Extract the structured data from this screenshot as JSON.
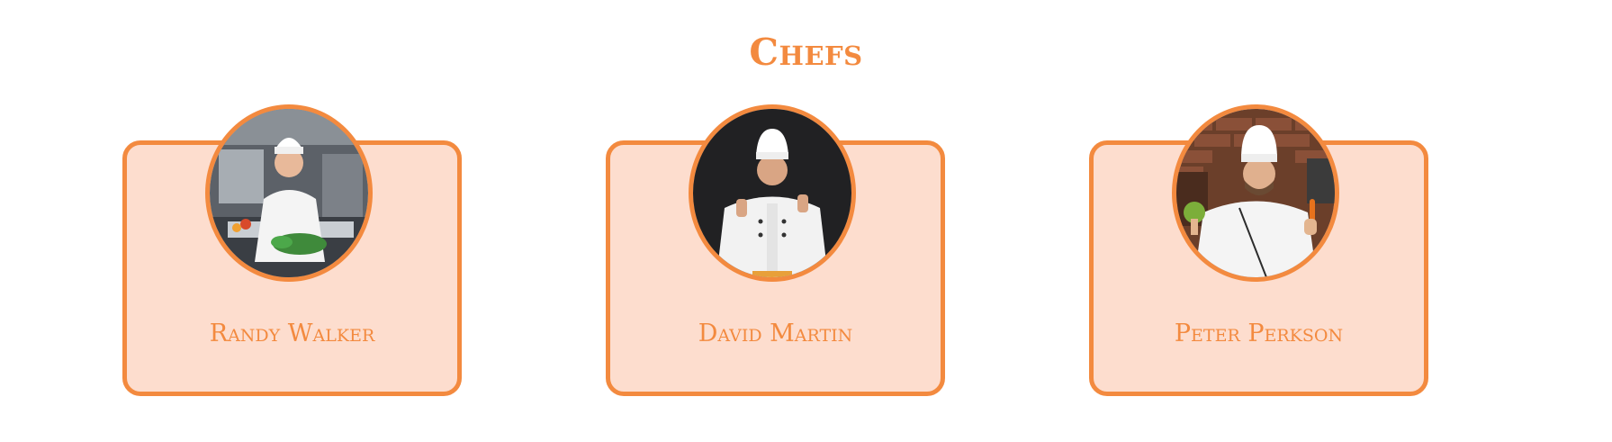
{
  "section": {
    "title": "Chefs"
  },
  "chefs": [
    {
      "name": "Randy Walker",
      "photo_icon": "chef-photo-kitchen-icon"
    },
    {
      "name": "David Martin",
      "photo_icon": "chef-photo-thumbs-up-icon"
    },
    {
      "name": "Peter Perkson",
      "photo_icon": "chef-photo-brick-wall-icon"
    }
  ],
  "colors": {
    "accent": "#f38a3f",
    "card_background": "#fdddce",
    "page_background": "#ffffff"
  }
}
